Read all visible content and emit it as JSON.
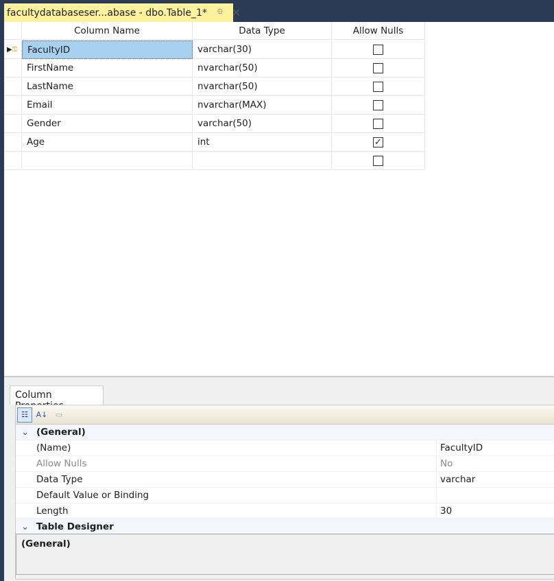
{
  "tab": {
    "title": "facultydatabaseser...abase - dbo.Table_1*",
    "pin_icon": "pin-icon",
    "close_icon": "close-icon"
  },
  "grid": {
    "headers": [
      "Column Name",
      "Data Type",
      "Allow Nulls"
    ],
    "rows": [
      {
        "name": "FacultyID",
        "type": "varchar(30)",
        "nulls": false,
        "primary_key": true,
        "selected": true
      },
      {
        "name": "FirstName",
        "type": "nvarchar(50)",
        "nulls": false
      },
      {
        "name": "LastName",
        "type": "nvarchar(50)",
        "nulls": false
      },
      {
        "name": "Email",
        "type": "nvarchar(MAX)",
        "nulls": false
      },
      {
        "name": "Gender",
        "type": "varchar(50)",
        "nulls": false
      },
      {
        "name": "Age",
        "type": "int",
        "nulls": true
      },
      {
        "name": "",
        "type": "",
        "nulls": false
      }
    ]
  },
  "properties": {
    "tab_label": "Column Properties",
    "categories": [
      {
        "label": "(General)"
      },
      {
        "label": "Table Designer"
      }
    ],
    "rows": [
      {
        "key": "(Name)",
        "value": "FacultyID"
      },
      {
        "key": "Allow Nulls",
        "value": "No",
        "disabled": true
      },
      {
        "key": "Data Type",
        "value": "varchar"
      },
      {
        "key": "Default Value or Binding",
        "value": ""
      },
      {
        "key": "Length",
        "value": "30"
      }
    ],
    "description": "(General)"
  },
  "colors": {
    "tab": "#fff29d",
    "selection": "#a8d0f0",
    "frame": "#2b3a55"
  }
}
